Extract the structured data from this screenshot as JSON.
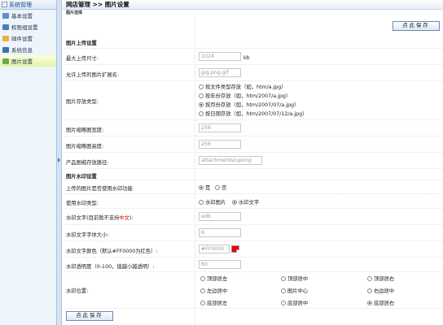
{
  "sidebar": {
    "header": "系统管理",
    "toggle": "-",
    "items": [
      {
        "label": "基本设置",
        "icon": "settings-icon"
      },
      {
        "label": "权限组设置",
        "icon": "group-icon"
      },
      {
        "label": "邮件设置",
        "icon": "mail-icon"
      },
      {
        "label": "系统信息",
        "icon": "info-icon"
      },
      {
        "label": "图片设置",
        "icon": "image-icon"
      }
    ]
  },
  "header": {
    "title": "网店管理 >> 图片设置",
    "subtab": "图片选择"
  },
  "buttons": {
    "save_top": "点此保存",
    "save_bottom": "点此保存"
  },
  "upload": {
    "section_title": "图片上传设置",
    "max_size_label": "最大上传尺寸:",
    "max_size_value": "1024",
    "max_size_unit": "kb",
    "allowed_ext_label": "允许上传的图片扩展名:",
    "allowed_ext_value": "jpg,png,gif",
    "storage_label": "图片存放类型:",
    "storage_options": [
      "按文件类型存放（如，htm/a.jpg）",
      "按年份存放（如，htm/2007/a.jpg）",
      "按月份存放（如，htm/2007/07/a.jpg）",
      "按日期存放（如，htm/2007/07/12/a.jpg）"
    ],
    "storage_selected": 2,
    "thumb_width_label": "图片缩略图宽度:",
    "thumb_width_value": "256",
    "thumb_height_label": "图片缩略图高度:",
    "thumb_height_value": "256",
    "product_path_label": "产品图缩存放路径:",
    "product_path_value": "attachments/upimg"
  },
  "watermark": {
    "section_title": "图片水印设置",
    "enable_label": "上传的图片是否使用水印功能",
    "enable_yes": "是",
    "enable_no": "否",
    "type_label": "使用水印类型:",
    "type_image": "水印图片",
    "type_text": "水印文字",
    "text_label_prefix": "水印文字(目前暂不支持",
    "text_label_red": "中文",
    "text_label_suffix": "):",
    "text_value": "edb",
    "font_size_label": "水印文字字体大小:",
    "font_size_value": "6",
    "color_label": "水印文字颜色（默认#FF0000为红色）:",
    "color_value": "#FF0000",
    "color_swatch": "#e8000a",
    "alpha_label": "水印透明度（0-100，值越小越透明）:",
    "alpha_value": "60",
    "position_label": "水印位置:",
    "positions": [
      "顶部居左",
      "顶部居中",
      "顶部居右",
      "左边居中",
      "图片中心",
      "右边居中",
      "底部居左",
      "底部居中",
      "底部居右"
    ],
    "position_selected": 8
  }
}
